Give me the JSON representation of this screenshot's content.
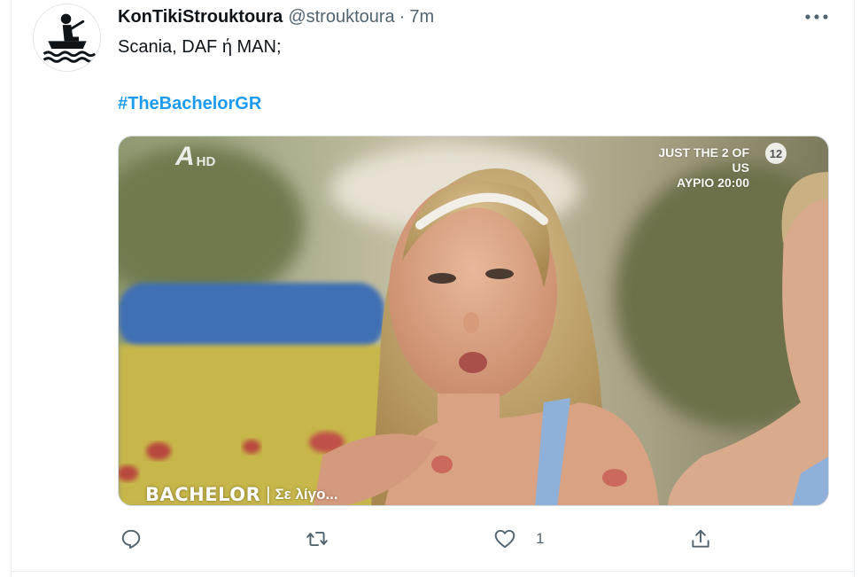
{
  "tweet": {
    "display_name": "KonTikiStrouktoura",
    "handle": "@strouktoura",
    "separator": "·",
    "time": "7m",
    "text": "Scania, DAF ή MAN;",
    "hashtag": "#TheBachelorGR",
    "avatar_icon": "boat-rower-icon",
    "more_icon": "more-dots-icon"
  },
  "media": {
    "channel_logo": "A",
    "channel_hd": "HD",
    "promo_line1": "JUST THE 2 OF US",
    "promo_line2": "ΑΥΡΙΟ 20:00",
    "rating": "12",
    "show_title": "BACHELOR",
    "show_separator": "|",
    "show_subtitle": "Σε λίγο..."
  },
  "actions": {
    "reply_icon": "reply-icon",
    "retweet_icon": "retweet-icon",
    "like_icon": "heart-icon",
    "like_count": "1",
    "share_icon": "share-icon"
  },
  "colors": {
    "link": "#1d9bf0",
    "secondary_text": "#536471",
    "primary_text": "#0f1419"
  }
}
